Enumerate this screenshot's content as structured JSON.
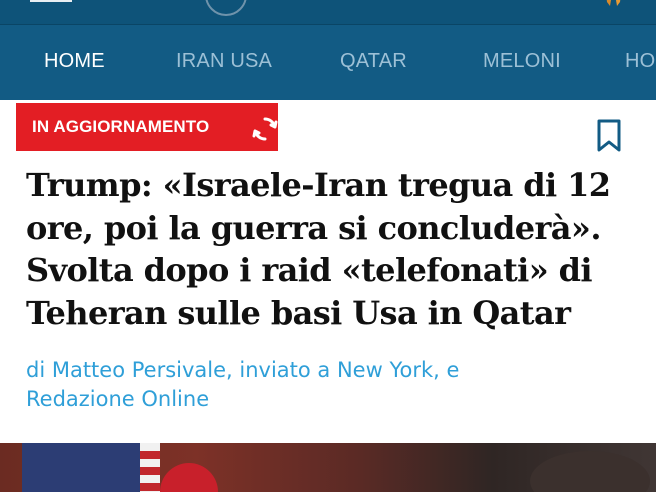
{
  "topbar": {
    "menu_icon": "hamburger-icon",
    "logo_icon": "logo-circle",
    "ribbon_icon": "ribbon-icon"
  },
  "nav": {
    "items": [
      {
        "label": "HOME",
        "active": true
      },
      {
        "label": "IRAN USA",
        "active": false
      },
      {
        "label": "QATAR",
        "active": false
      },
      {
        "label": "MELONI",
        "active": false
      },
      {
        "label": "HO",
        "active": false
      }
    ]
  },
  "article": {
    "live_badge": "IN AGGIORNAMENTO",
    "headline": "Trump: «Israele-Iran tregua di 12 ore, poi la guerra si concluderà». Svolta dopo i raid «telefonati» di Teheran sulle basi Usa in Qatar",
    "byline": "di Matteo Persivale, inviato a New York, e Redazione Online"
  },
  "colors": {
    "nav_bg": "#125b84",
    "badge_red": "#e31e24",
    "byline_blue": "#2f9fd8"
  }
}
